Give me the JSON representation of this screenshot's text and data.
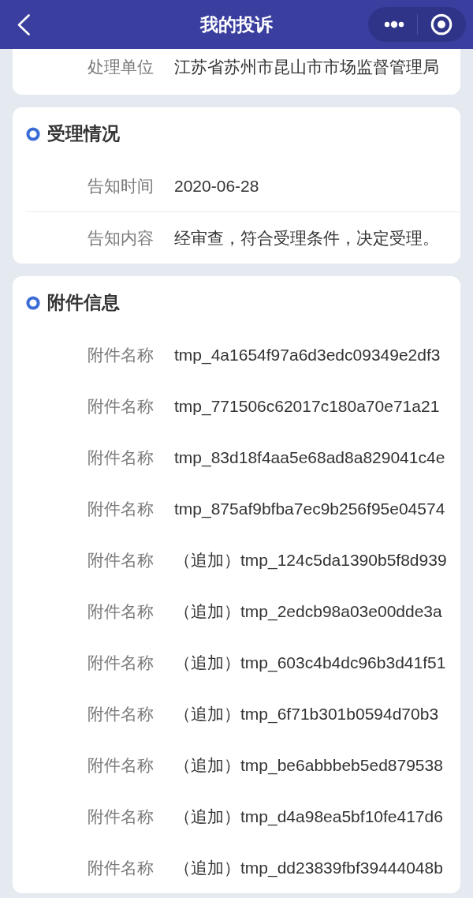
{
  "nav_bar": {
    "title": "我的投诉"
  },
  "sections": [
    {
      "kind": "info",
      "rows": [
        {
          "label": "处理单位",
          "value": "江苏省苏州市昆山市市场监督管理局"
        }
      ]
    },
    {
      "kind": "info",
      "title": "受理情况",
      "rows": [
        {
          "label": "告知时间",
          "value": "2020-06-28"
        },
        {
          "label": "告知内容",
          "value": "经审查，符合受理条件，决定受理。"
        }
      ]
    },
    {
      "kind": "files",
      "title": "附件信息",
      "rows": [
        {
          "label": "附件名称",
          "value": "tmp_4a1654f97a6d3edc09349e2df3"
        },
        {
          "label": "附件名称",
          "value": "tmp_771506c62017c180a70e71a21"
        },
        {
          "label": "附件名称",
          "value": "tmp_83d18f4aa5e68ad8a829041c4e"
        },
        {
          "label": "附件名称",
          "value": "tmp_875af9bfba7ec9b256f95e04574"
        },
        {
          "label": "附件名称",
          "value": "（追加）tmp_124c5da1390b5f8d939"
        },
        {
          "label": "附件名称",
          "value": "（追加）tmp_2edcb98a03e00dde3a"
        },
        {
          "label": "附件名称",
          "value": "（追加）tmp_603c4b4dc96b3d41f51"
        },
        {
          "label": "附件名称",
          "value": "（追加）tmp_6f71b301b0594d70b3"
        },
        {
          "label": "附件名称",
          "value": "（追加）tmp_be6abbbeb5ed879538"
        },
        {
          "label": "附件名称",
          "value": "（追加）tmp_d4a98ea5bf10fe417d6"
        },
        {
          "label": "附件名称",
          "value": "（追加）tmp_dd23839fbf39444048b"
        }
      ]
    }
  ]
}
